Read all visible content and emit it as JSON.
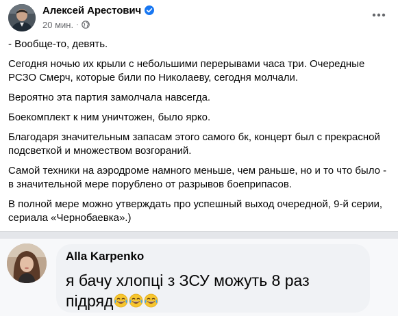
{
  "post": {
    "author": "Алексей Арестович",
    "time": "20 мин.",
    "separator": "·",
    "paragraphs": [
      "- Вообще-то, девять.",
      "Сегодня ночью их крыли с небольшими перерывами часа три. Очередные РСЗО Смерч, которые били по Николаеву, сегодня молчали.",
      "Вероятно эта партия замолчала навсегда.",
      "Боекомплект к ним уничтожен, было ярко.",
      "Благодаря значительным запасам этого самого бк, концерт был с прекрасной подсветкой и множеством возгораний.",
      "Самой техники на аэродроме намного меньше, чем раньше, но и то что было - в значительной мере порублено от разрывов боеприпасов.",
      "В полной мере можно утверждать про успешный выход очередной, 9-й серии, сериала «Чернобаевка».)"
    ],
    "icons": {
      "verified": "verified-badge-icon",
      "audience": "globe-icon",
      "more": "more-options-icon"
    }
  },
  "comment": {
    "author": "Alla Karpenko",
    "text": "я бачу хлопці з ЗСУ можуть 8 раз підряд",
    "emoji": [
      "😂",
      "😂",
      "😂"
    ]
  },
  "colors": {
    "accent": "#1877f2",
    "secondary_text": "#65676b",
    "bubble": "#f0f2f5",
    "separator": "#e4e6ea"
  }
}
